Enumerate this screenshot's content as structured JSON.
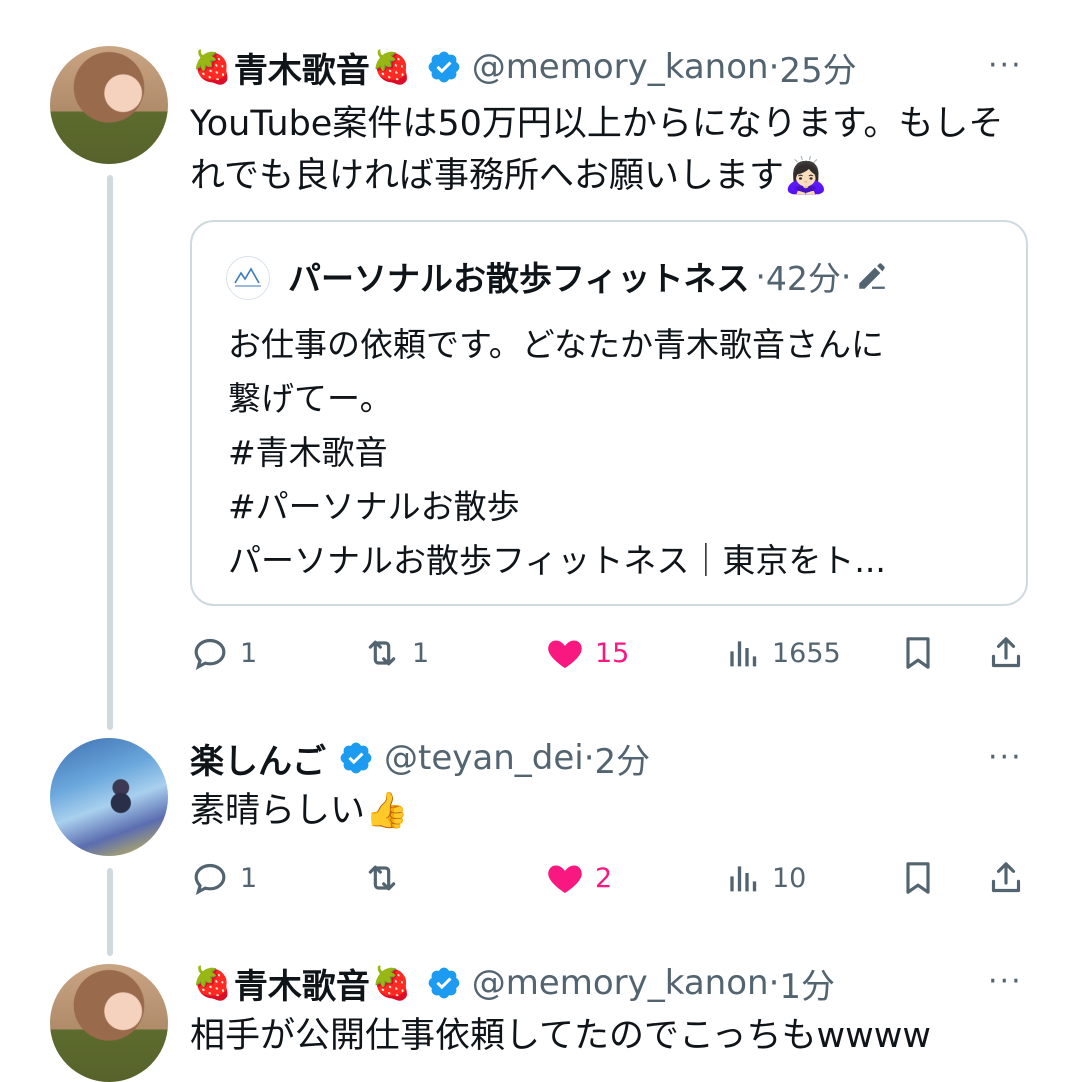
{
  "posts": [
    {
      "name": "青木歌音",
      "handle": "@memory_kanon",
      "sep": "·",
      "time": "25分",
      "more": "···",
      "text": "YouTube案件は50万円以上からになります。もしそれでも良ければ事務所へお願いします🙇🏻‍♀️",
      "quote": {
        "name": "パーソナルお散歩フィットネス",
        "sep": "·",
        "time": "42分",
        "sep2": "·",
        "text": "お仕事の依頼です。どなたか青木歌音さんに\n繋げてー。\n#青木歌音\n#パーソナルお散歩\nパーソナルお散歩フィットネス｜東京をト..."
      },
      "stats": {
        "replies": "1",
        "retweets": "1",
        "likes": "15",
        "views": "1655"
      }
    },
    {
      "name": "楽しんご",
      "handle": "@teyan_dei",
      "sep": "·",
      "time": "2分",
      "more": "···",
      "text": "素晴らしい👍",
      "stats": {
        "replies": "1",
        "retweets": "",
        "likes": "2",
        "views": "10"
      }
    },
    {
      "name": "青木歌音",
      "handle": "@memory_kanon",
      "sep": "·",
      "time": "1分",
      "more": "···",
      "text": "相手が公開仕事依頼してたのでこっちもwwww"
    }
  ],
  "emoji": {
    "strawberry": "🍓"
  },
  "icons": [
    "reply-icon",
    "retweet-icon",
    "heart-icon",
    "views-icon",
    "bookmark-icon",
    "share-icon",
    "verified-badge-icon",
    "edit-pencil-icon"
  ],
  "colors": {
    "like": "#f91880",
    "verified": "#1d9bf0",
    "muted": "#536471",
    "border": "#cfd9de"
  }
}
